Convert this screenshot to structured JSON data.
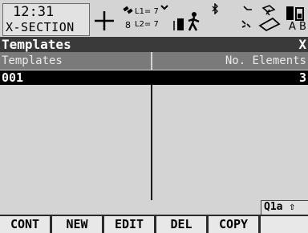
{
  "status": {
    "time": "12:31",
    "mode": "X-SECTION",
    "sat_count": "8",
    "l1_label": "L1= 7",
    "l2_label": "L2= 7",
    "keyboard_label": "A B"
  },
  "dialog": {
    "title": "Templates",
    "close": "X"
  },
  "table": {
    "headers": [
      "Templates",
      "No. Elements"
    ],
    "rows": [
      {
        "name": "001",
        "elements": "3"
      }
    ]
  },
  "input_indicator": "Q1a ⇧",
  "softkeys": [
    "CONT",
    "NEW",
    "EDIT",
    "DEL",
    "COPY"
  ],
  "icons": [
    "crosshair-icon",
    "satellite-icon",
    "bluetooth-icon",
    "radio-phone-icon",
    "walker-icon",
    "signal-icon",
    "memory-card-icon",
    "battery-icon"
  ]
}
